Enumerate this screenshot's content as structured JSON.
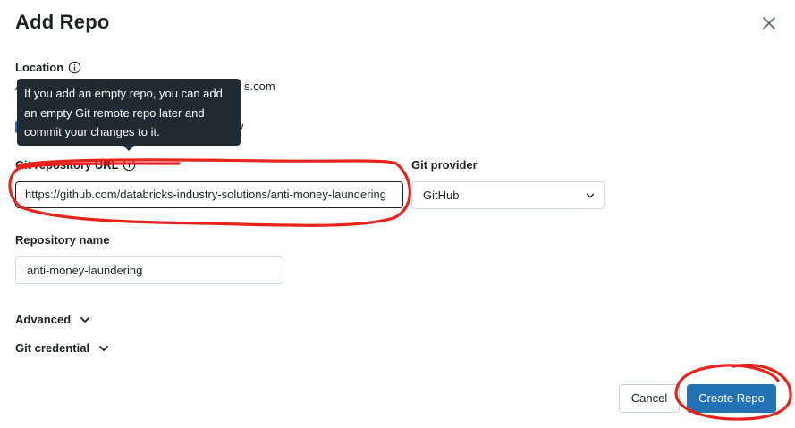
{
  "dialog": {
    "title": "Add Repo"
  },
  "location": {
    "label": "Location",
    "value_prefix": "A",
    "value_suffix": "s.com"
  },
  "tooltip": {
    "line1": "If you add an empty repo, you can add",
    "line2": "an empty Git remote repo later and",
    "line3": "commit your changes to it."
  },
  "checkbox_row": {
    "visible_tail": "y"
  },
  "git_url": {
    "label": "Git repository URL",
    "value": "https://github.com/databricks-industry-solutions/anti-money-laundering"
  },
  "git_provider": {
    "label": "Git provider",
    "selected": "GitHub"
  },
  "repo_name": {
    "label": "Repository name",
    "value": "anti-money-laundering"
  },
  "advanced": {
    "label": "Advanced"
  },
  "git_credential": {
    "label": "Git credential"
  },
  "footer": {
    "cancel_label": "Cancel",
    "create_label": "Create Repo"
  },
  "colors": {
    "primary": "#2272b4",
    "tooltip_bg": "#1f2a33",
    "annotation": "#e8231b"
  },
  "icons": [
    "close-icon",
    "info-icon",
    "chevron-down-icon"
  ]
}
